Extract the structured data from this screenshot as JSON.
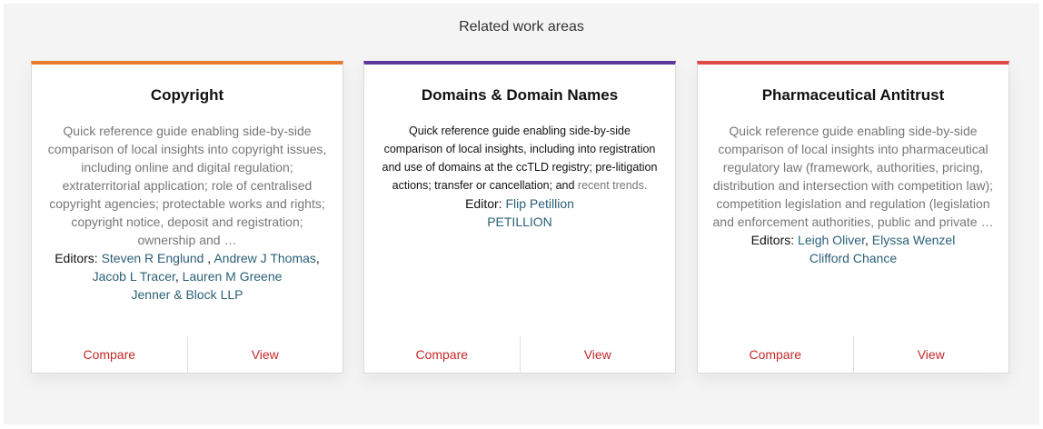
{
  "section_title": "Related work areas",
  "cards": [
    {
      "accent": "#e87a2f",
      "title": "Copyright",
      "description": "Quick reference guide enabling side-by-side comparison of local insights into copyright issues, including online and digital regulation; extraterritorial application; role of centralised copyright agencies; protectable works and rights; copyright notice, deposit and registration; ownership and …",
      "editors_label": "Editors:",
      "editors": [
        "Steven R Englund",
        "Andrew J Thomas",
        "Jacob L Tracer",
        "Lauren M Greene"
      ],
      "firm": "Jenner & Block LLP",
      "compare": "Compare",
      "view": "View"
    },
    {
      "accent": "#5b3a9b",
      "title": "Domains & Domain Names",
      "description": "Quick reference guide enabling side-by-side comparison of local insights, including into registration and use of domains at the ccTLD registry; pre-litigation actions; transfer or cancellation; and",
      "description_tail": "recent trends.",
      "editors_label": "Editor:",
      "editors": [
        "Flip Petillion"
      ],
      "firm": "PETILLION",
      "compare": "Compare",
      "view": "View"
    },
    {
      "accent": "#e04848",
      "title": "Pharmaceutical Antitrust",
      "description": "Quick reference guide enabling side-by-side comparison of local insights into pharmaceutical regulatory law (framework, authorities, pricing, distribution and intersection with competition law); competition legislation and regulation (legislation and enforcement authorities, public and private …",
      "editors_label": "Editors:",
      "editors": [
        "Leigh Oliver",
        "Elyssa Wenzel"
      ],
      "firm": "Clifford Chance",
      "compare": "Compare",
      "view": "View"
    }
  ]
}
